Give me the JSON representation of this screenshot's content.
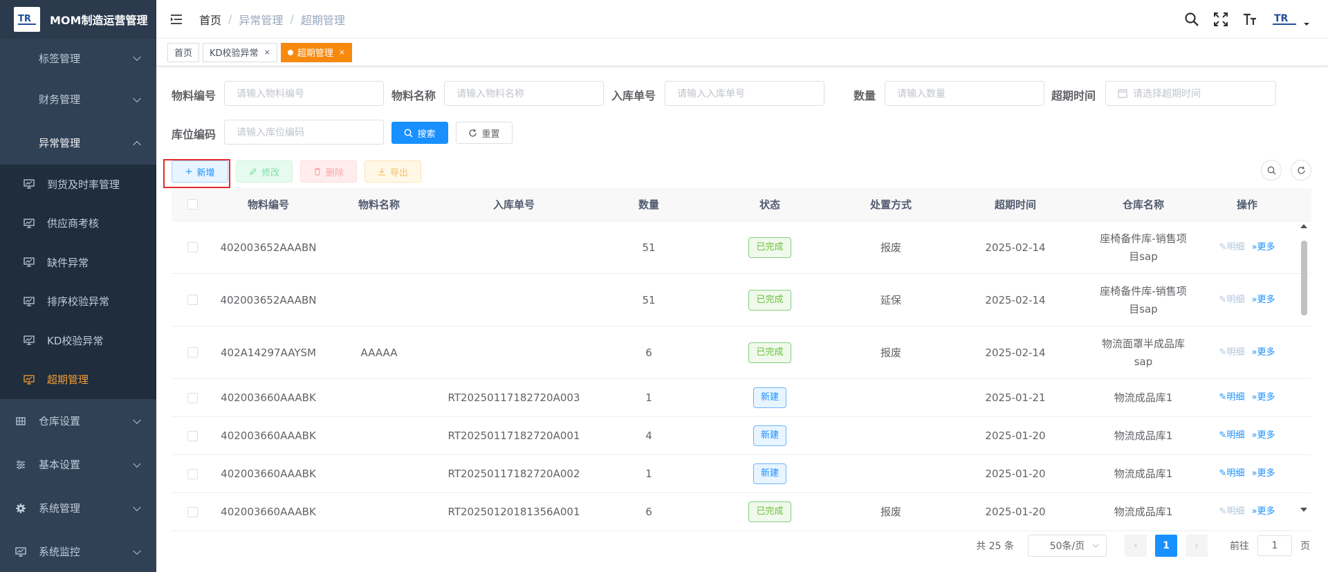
{
  "app": {
    "title": "MOM制造运营管理"
  },
  "sidebar": {
    "top": [
      {
        "label": "标签管理"
      },
      {
        "label": "财务管理"
      },
      {
        "label": "异常管理"
      }
    ],
    "sub": [
      {
        "label": "到货及时率管理"
      },
      {
        "label": "供应商考核"
      },
      {
        "label": "缺件异常"
      },
      {
        "label": "排序校验异常"
      },
      {
        "label": "KD校验异常"
      },
      {
        "label": "超期管理"
      }
    ],
    "bottom": [
      {
        "label": "仓库设置"
      },
      {
        "label": "基本设置"
      },
      {
        "label": "系统管理"
      },
      {
        "label": "系统监控"
      }
    ]
  },
  "breadcrumb": [
    "首页",
    "异常管理",
    "超期管理"
  ],
  "tags": [
    "首页",
    "KD校验异常",
    "超期管理"
  ],
  "form": {
    "material_code": {
      "label": "物料编号",
      "placeholder": "请输入物料编号"
    },
    "material_name": {
      "label": "物料名称",
      "placeholder": "请输入物料名称"
    },
    "inbound_no": {
      "label": "入库单号",
      "placeholder": "请输入入库单号"
    },
    "quantity": {
      "label": "数量",
      "placeholder": "请输入数量"
    },
    "overdue_time": {
      "label": "超期时间",
      "placeholder": "请选择超期时间"
    },
    "location_code": {
      "label": "库位编码",
      "placeholder": "请输入库位编码"
    },
    "search_btn": "搜索",
    "reset_btn": "重置"
  },
  "toolbar": {
    "add": "新增",
    "edit": "修改",
    "delete": "删除",
    "export": "导出"
  },
  "table": {
    "columns": [
      "物料编号",
      "物料名称",
      "入库单号",
      "数量",
      "状态",
      "处置方式",
      "超期时间",
      "仓库名称",
      "操作"
    ],
    "rows": [
      {
        "code": "402003652AAABN",
        "name": "",
        "inbound": "",
        "qty": "51",
        "status": "已完成",
        "disposal": "报废",
        "date": "2025-02-14",
        "warehouse": "座椅备件库-销售项目sap",
        "op1": "明细",
        "op2": "更多"
      },
      {
        "code": "402003652AAABN",
        "name": "",
        "inbound": "",
        "qty": "51",
        "status": "已完成",
        "disposal": "延保",
        "date": "2025-02-14",
        "warehouse": "座椅备件库-销售项目sap",
        "op1": "明细",
        "op2": "更多"
      },
      {
        "code": "402A14297AAYSM",
        "name": "AAAAA",
        "inbound": "",
        "qty": "6",
        "status": "已完成",
        "disposal": "报废",
        "date": "2025-02-14",
        "warehouse": "物流面罩半成品库sap",
        "op1": "明细",
        "op2": "更多"
      },
      {
        "code": "402003660AAABK",
        "name": "",
        "inbound": "RT20250117182720A003",
        "qty": "1",
        "status": "新建",
        "disposal": "",
        "date": "2025-01-21",
        "warehouse": "物流成品库1",
        "op1": "明细",
        "op2": "更多"
      },
      {
        "code": "402003660AAABK",
        "name": "",
        "inbound": "RT20250117182720A001",
        "qty": "4",
        "status": "新建",
        "disposal": "",
        "date": "2025-01-20",
        "warehouse": "物流成品库1",
        "op1": "明细",
        "op2": "更多"
      },
      {
        "code": "402003660AAABK",
        "name": "",
        "inbound": "RT20250117182720A002",
        "qty": "1",
        "status": "新建",
        "disposal": "",
        "date": "2025-01-20",
        "warehouse": "物流成品库1",
        "op1": "明细",
        "op2": "更多"
      },
      {
        "code": "402003660AAABK",
        "name": "",
        "inbound": "RT20250120181356A001",
        "qty": "6",
        "status": "已完成",
        "disposal": "报废",
        "date": "2025-01-20",
        "warehouse": "物流成品库1",
        "op1": "明细",
        "op2": "更多"
      }
    ]
  },
  "pagination": {
    "total": "共 25 条",
    "page_size": "50条/页",
    "current": "1",
    "goto_prefix": "前往",
    "goto_value": "1",
    "goto_suffix": "页"
  },
  "colors": {
    "sidebar": "#304156",
    "accent": "#f7890f",
    "primary": "#1890ff",
    "highlight": "#e5282b"
  }
}
